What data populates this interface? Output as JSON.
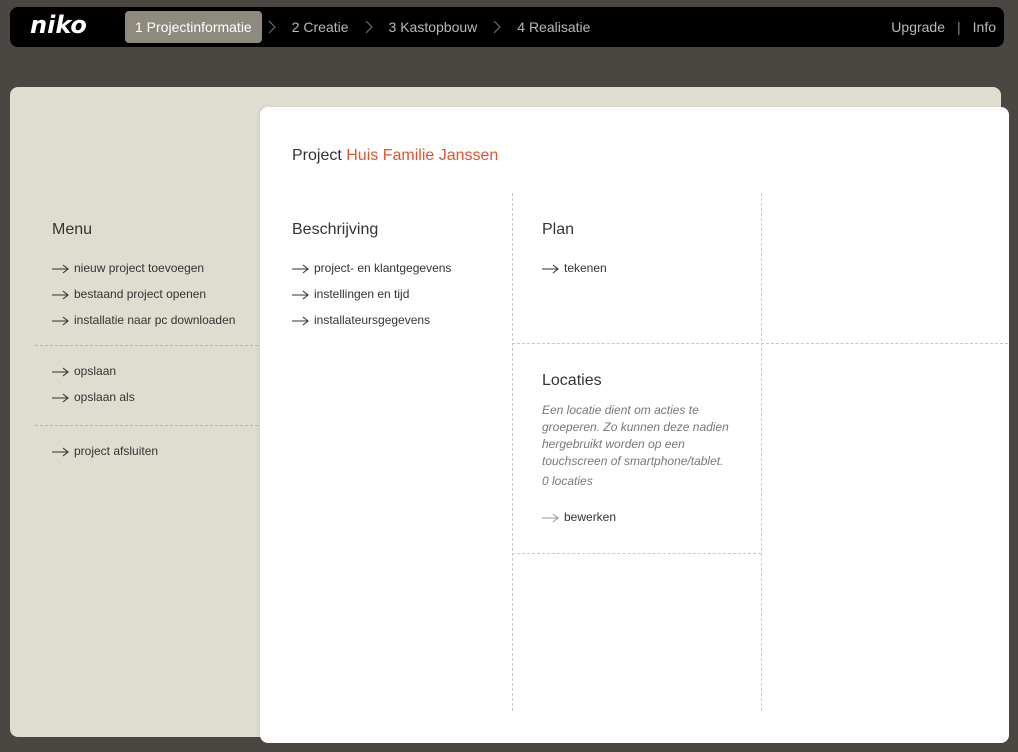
{
  "brand": {
    "logo": "niko"
  },
  "steps": [
    {
      "label": "1 Projectinformatie",
      "active": true
    },
    {
      "label": "2 Creatie",
      "active": false
    },
    {
      "label": "3 Kastopbouw",
      "active": false
    },
    {
      "label": "4 Realisatie",
      "active": false
    }
  ],
  "topright": {
    "upgrade": "Upgrade",
    "separator": "|",
    "info": "Info"
  },
  "menu": {
    "title": "Menu",
    "group1": [
      "nieuw project toevoegen",
      "bestaand project openen",
      "installatie naar pc downloaden"
    ],
    "group2": [
      "opslaan",
      "opslaan als"
    ],
    "group3": [
      "project afsluiten"
    ]
  },
  "project": {
    "prefix": "Project",
    "name": "Huis Familie Janssen"
  },
  "beschrijving": {
    "title": "Beschrijving",
    "links": [
      "project- en klantgegevens",
      "instellingen en tijd",
      "installateursgegevens"
    ]
  },
  "plan": {
    "title": "Plan",
    "links": [
      "tekenen"
    ]
  },
  "locaties": {
    "title": "Locaties",
    "description": "Een locatie dient om acties te groeperen. Zo kunnen deze nadien hergebruikt worden op een touchscreen of smartphone/tablet.",
    "count": "0 locaties",
    "edit": "bewerken"
  },
  "colors": {
    "accent": "#e2542c",
    "panel": "#deddd0",
    "background": "#4a4641",
    "activeStep": "#8e8a7e"
  },
  "icons": {
    "link_arrow": "arrow-right-icon",
    "step_separator": "chevron-right-icon"
  }
}
